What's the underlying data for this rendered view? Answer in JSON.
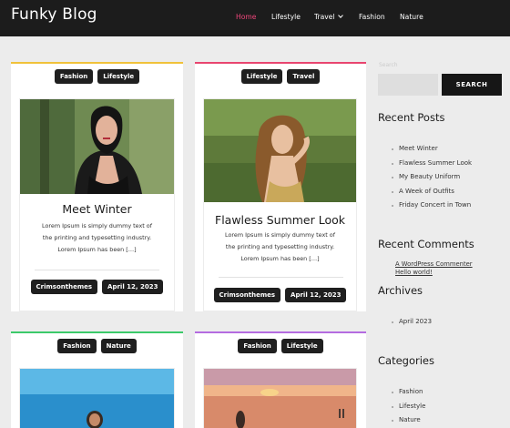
{
  "header": {
    "brand": "Funky Blog",
    "nav": [
      {
        "label": "Home"
      },
      {
        "label": "Lifestyle"
      },
      {
        "label": "Travel"
      },
      {
        "label": "Fashion"
      },
      {
        "label": "Nature"
      }
    ]
  },
  "posts": [
    {
      "tags": [
        "Fashion",
        "Lifestyle"
      ],
      "title": "Meet Winter",
      "excerpt": [
        "Lorem Ipsum is simply dummy text of",
        "the printing and typesetting industry.",
        "Lorem Ipsum has been […]"
      ],
      "author": "Crimsonthemes",
      "date": "April 12, 2023",
      "accent": "#f0c23a"
    },
    {
      "tags": [
        "Lifestyle",
        "Travel"
      ],
      "title": "Flawless Summer Look",
      "excerpt": [
        "Lorem Ipsum is simply dummy text of",
        "the printing and typesetting industry.",
        "Lorem Ipsum has been […]"
      ],
      "author": "Crimsonthemes",
      "date": "April 12, 2023",
      "accent": "#e8456f"
    },
    {
      "tags": [
        "Fashion",
        "Nature"
      ],
      "accent": "#3cc96a"
    },
    {
      "tags": [
        "Fashion",
        "Lifestyle"
      ],
      "accent": "#b46be0"
    }
  ],
  "sidebar": {
    "search": {
      "label": "Search",
      "button": "SEARCH",
      "placeholder": ""
    },
    "recent_posts": {
      "title": "Recent Posts",
      "items": [
        "Meet Winter",
        "Flawless Summer Look",
        "My Beauty Uniform",
        "A Week of Outfits",
        "Friday Concert in Town"
      ]
    },
    "recent_comments": {
      "title": "Recent Comments",
      "author": "A WordPress Commenter",
      "on": "Hello world!"
    },
    "archives": {
      "title": "Archives",
      "items": [
        "April 2023"
      ]
    },
    "categories": {
      "title": "Categories",
      "items": [
        "Fashion",
        "Lifestyle",
        "Nature"
      ]
    }
  },
  "colors": {
    "header_bg": "#1c1c1c",
    "nav_active": "#f0467b",
    "page_bg": "#ececec"
  }
}
